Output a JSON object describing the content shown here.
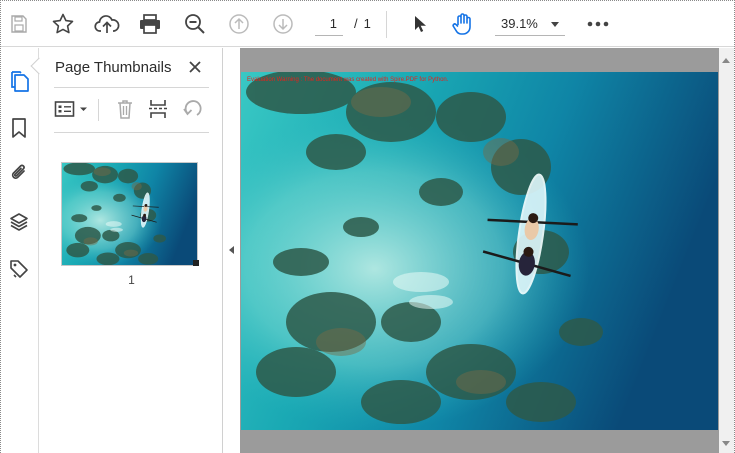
{
  "toolbar": {
    "icons": [
      "save-icon",
      "star-icon",
      "cloud-upload-icon",
      "print-icon",
      "zoom-out-icon",
      "page-up-icon",
      "page-down-icon",
      "select-cursor-icon",
      "hand-icon",
      "more-icon"
    ],
    "current_page": "1",
    "separator": "/",
    "total_pages": "1",
    "zoom": "39.1%"
  },
  "rail": {
    "icons": [
      "page-thumbnails-icon",
      "bookmark-icon",
      "attachment-icon",
      "layers-icon",
      "tags-icon"
    ]
  },
  "panel": {
    "title": "Page Thumbnails",
    "thumbnail_label": "1"
  },
  "document": {
    "watermark": "Evaluation Warning : The document was created with Spire.PDF for Python."
  },
  "colors": {
    "accent": "#1473e6",
    "water_dark": "#0b4f78",
    "water_light": "#3fd0d2",
    "watermark": "#e8211b"
  }
}
